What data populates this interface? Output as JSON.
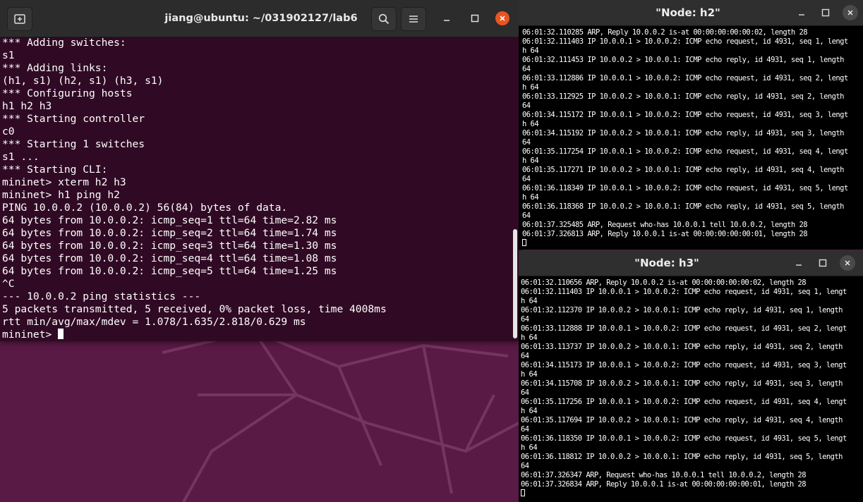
{
  "colors": {
    "desktop": "#5a1a46",
    "terminal_bg": "#300a24",
    "close_accent": "#e95420"
  },
  "terminal": {
    "title": "jiang@ubuntu: ~/031902127/lab6",
    "icons": [
      "new-tab-icon",
      "search-icon",
      "hamburger-menu-icon",
      "minimize-icon",
      "maximize-icon",
      "close-icon"
    ],
    "lines": [
      "*** Adding switches:",
      "s1",
      "*** Adding links:",
      "(h1, s1) (h2, s1) (h3, s1)",
      "*** Configuring hosts",
      "h1 h2 h3",
      "*** Starting controller",
      "c0",
      "*** Starting 1 switches",
      "s1 ...",
      "*** Starting CLI:",
      "mininet> xterm h2 h3",
      "mininet> h1 ping h2",
      "PING 10.0.0.2 (10.0.0.2) 56(84) bytes of data.",
      "64 bytes from 10.0.0.2: icmp_seq=1 ttl=64 time=2.82 ms",
      "64 bytes from 10.0.0.2: icmp_seq=2 ttl=64 time=1.74 ms",
      "64 bytes from 10.0.0.2: icmp_seq=3 ttl=64 time=1.30 ms",
      "64 bytes from 10.0.0.2: icmp_seq=4 ttl=64 time=1.08 ms",
      "64 bytes from 10.0.0.2: icmp_seq=5 ttl=64 time=1.25 ms",
      "^C",
      "--- 10.0.0.2 ping statistics ---",
      "5 packets transmitted, 5 received, 0% packet loss, time 4008ms",
      "rtt min/avg/max/mdev = 1.078/1.635/2.818/0.629 ms"
    ],
    "prompt": "mininet> "
  },
  "xterm_h2": {
    "title": "\"Node: h2\"",
    "lines": [
      "06:01:32.110285 ARP, Reply 10.0.0.2 is-at 00:00:00:00:00:02, length 28",
      "06:01:32.111403 IP 10.0.0.1 > 10.0.0.2: ICMP echo request, id 4931, seq 1, lengt",
      "h 64",
      "06:01:32.111453 IP 10.0.0.2 > 10.0.0.1: ICMP echo reply, id 4931, seq 1, length",
      "64",
      "06:01:33.112886 IP 10.0.0.1 > 10.0.0.2: ICMP echo request, id 4931, seq 2, lengt",
      "h 64",
      "06:01:33.112925 IP 10.0.0.2 > 10.0.0.1: ICMP echo reply, id 4931, seq 2, length",
      "64",
      "06:01:34.115172 IP 10.0.0.1 > 10.0.0.2: ICMP echo request, id 4931, seq 3, lengt",
      "h 64",
      "06:01:34.115192 IP 10.0.0.2 > 10.0.0.1: ICMP echo reply, id 4931, seq 3, length",
      "64",
      "06:01:35.117254 IP 10.0.0.1 > 10.0.0.2: ICMP echo request, id 4931, seq 4, lengt",
      "h 64",
      "06:01:35.117271 IP 10.0.0.2 > 10.0.0.1: ICMP echo reply, id 4931, seq 4, length",
      "64",
      "06:01:36.118349 IP 10.0.0.1 > 10.0.0.2: ICMP echo request, id 4931, seq 5, lengt",
      "h 64",
      "06:01:36.118368 IP 10.0.0.2 > 10.0.0.1: ICMP echo reply, id 4931, seq 5, length",
      "64",
      "06:01:37.325485 ARP, Request who-has 10.0.0.1 tell 10.0.0.2, length 28",
      "06:01:37.326813 ARP, Reply 10.0.0.1 is-at 00:00:00:00:00:01, length 28"
    ]
  },
  "xterm_h3": {
    "title": "\"Node: h3\"",
    "lines": [
      "06:01:32.110656 ARP, Reply 10.0.0.2 is-at 00:00:00:00:00:02, length 28",
      "06:01:32.111403 IP 10.0.0.1 > 10.0.0.2: ICMP echo request, id 4931, seq 1, lengt",
      "h 64",
      "06:01:32.112370 IP 10.0.0.2 > 10.0.0.1: ICMP echo reply, id 4931, seq 1, length",
      "64",
      "06:01:33.112888 IP 10.0.0.1 > 10.0.0.2: ICMP echo request, id 4931, seq 2, lengt",
      "h 64",
      "06:01:33.113737 IP 10.0.0.2 > 10.0.0.1: ICMP echo reply, id 4931, seq 2, length",
      "64",
      "06:01:34.115173 IP 10.0.0.1 > 10.0.0.2: ICMP echo request, id 4931, seq 3, lengt",
      "h 64",
      "06:01:34.115708 IP 10.0.0.2 > 10.0.0.1: ICMP echo reply, id 4931, seq 3, length",
      "64",
      "06:01:35.117256 IP 10.0.0.1 > 10.0.0.2: ICMP echo request, id 4931, seq 4, lengt",
      "h 64",
      "06:01:35.117694 IP 10.0.0.2 > 10.0.0.1: ICMP echo reply, id 4931, seq 4, length",
      "64",
      "06:01:36.118350 IP 10.0.0.1 > 10.0.0.2: ICMP echo request, id 4931, seq 5, lengt",
      "h 64",
      "06:01:36.118812 IP 10.0.0.2 > 10.0.0.1: ICMP echo reply, id 4931, seq 5, length",
      "64",
      "06:01:37.326347 ARP, Request who-has 10.0.0.1 tell 10.0.0.2, length 28",
      "06:01:37.326834 ARP, Reply 10.0.0.1 is-at 00:00:00:00:00:01, length 28"
    ]
  }
}
